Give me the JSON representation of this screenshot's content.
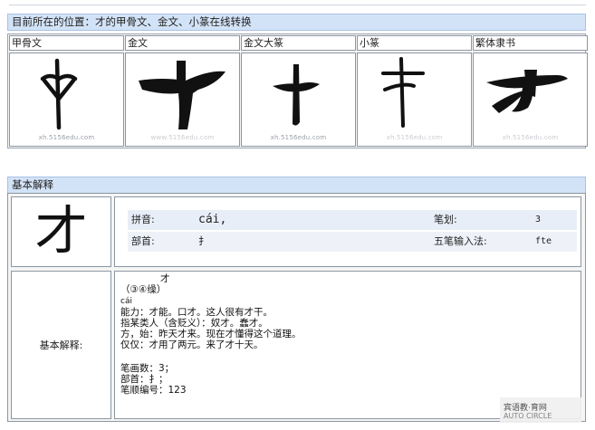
{
  "location_bar": {
    "text": "目前所在的位置：才的甲骨文、金文、小篆在线转换"
  },
  "script_forms": [
    {
      "label": "甲骨文",
      "watermark": "xh.5156edu.com"
    },
    {
      "label": "金文",
      "watermark": "www.5156edu.com"
    },
    {
      "label": "金文大篆",
      "watermark": "xh.5156edu.com"
    },
    {
      "label": "小篆",
      "watermark": "xh.5156edu.com"
    },
    {
      "label": "繁体隶书",
      "watermark": "xh.5156edu.com"
    }
  ],
  "basic_section": {
    "header": "基本解释",
    "character": "才",
    "pinyin_label": "拼音:",
    "pinyin_value": "cái,",
    "radical_label": "部首:",
    "radical_value": "扌",
    "strokes_label": "笔划:",
    "strokes_value": "3",
    "wubi_label": "五笔输入法:",
    "wubi_value": "fte",
    "explain_label": "基本解释:",
    "explain_lines": {
      "l1": "才",
      "l2": "（③④缲）",
      "l3": "cái",
      "l4": "能力：才能。口才。这人很有才干。",
      "l5": "指某类人（含贬义）：奴才。蠢才。",
      "l6": "方，始：昨天才来。现在才懂得这个道理。",
      "l7": "仅仅：才用了两元。来了才十天。",
      "l8": "笔画数：3；",
      "l9": "部首：扌；",
      "l10": "笔顺编号：123"
    }
  },
  "corner_logo": {
    "line1": "宾语教·育网",
    "line2": "AUTO CIRCLE"
  }
}
